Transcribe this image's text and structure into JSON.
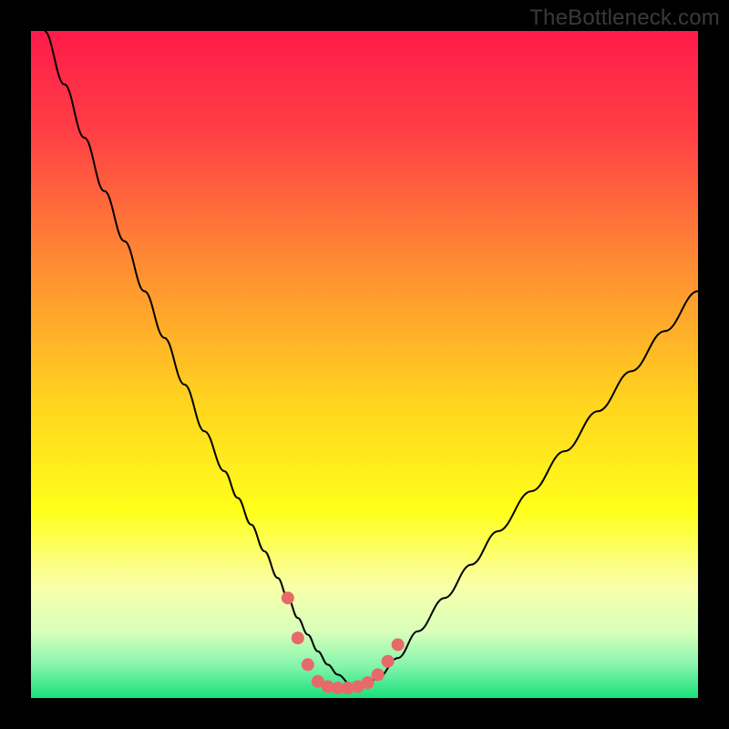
{
  "watermark": "TheBottleneck.com",
  "chart_data": {
    "type": "line",
    "title": "",
    "xlabel": "",
    "ylabel": "",
    "xlim": [
      0,
      100
    ],
    "ylim": [
      0,
      100
    ],
    "background_gradient": {
      "stops": [
        {
          "t": 0.0,
          "color": "#ff1a4b"
        },
        {
          "t": 0.15,
          "color": "#ff3f45"
        },
        {
          "t": 0.35,
          "color": "#ff8c33"
        },
        {
          "t": 0.55,
          "color": "#ffd21f"
        },
        {
          "t": 0.72,
          "color": "#ffff1a"
        },
        {
          "t": 0.83,
          "color": "#faffa8"
        },
        {
          "t": 0.9,
          "color": "#d8ffba"
        },
        {
          "t": 0.95,
          "color": "#88f5ad"
        },
        {
          "t": 1.0,
          "color": "#18e07a"
        }
      ]
    },
    "series": [
      {
        "name": "bottleneck-curve",
        "color": "#000000",
        "stroke_width": 2,
        "x": [
          2,
          5,
          8,
          11,
          14,
          17,
          20,
          23,
          26,
          29,
          31,
          33,
          35,
          37,
          38.5,
          40,
          41.5,
          43,
          44.5,
          46,
          48,
          50,
          52,
          55,
          58,
          62,
          66,
          70,
          75,
          80,
          85,
          90,
          95,
          100
        ],
        "y": [
          100,
          92,
          84,
          76,
          68.5,
          61,
          54,
          47,
          40,
          34,
          30,
          26,
          22,
          18,
          15,
          12,
          9.5,
          7,
          5,
          3.5,
          2,
          1.8,
          3,
          6,
          10,
          15,
          20,
          25,
          31,
          37,
          43,
          49,
          55,
          61
        ]
      }
    ],
    "markers": {
      "name": "trough-points",
      "color": "#e76a6a",
      "radius": 7,
      "x": [
        38.5,
        40,
        41.5,
        43,
        44.5,
        46,
        47.5,
        49,
        50.5,
        52,
        53.5,
        55
      ],
      "y": [
        15,
        9,
        5,
        2.5,
        1.7,
        1.5,
        1.5,
        1.7,
        2.3,
        3.5,
        5.5,
        8
      ]
    }
  }
}
